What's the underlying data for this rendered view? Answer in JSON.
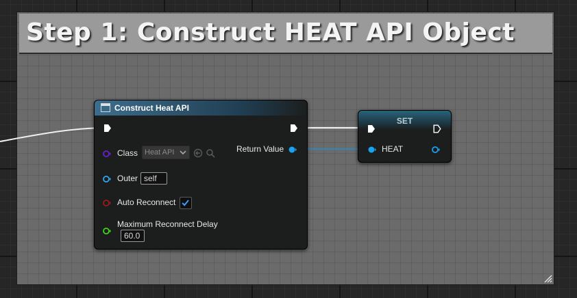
{
  "comment": {
    "title": "Step 1: Construct HEAT API Object"
  },
  "construct_node": {
    "title": "Construct Heat API",
    "icon": "function-icon",
    "header_color": "#3d6d8e",
    "inputs": {
      "class": {
        "label": "Class",
        "value": "Heat API",
        "pin_color": "#6a1fd0"
      },
      "outer": {
        "label": "Outer",
        "value": "self",
        "pin_color": "#2fa7f0"
      },
      "auto_reconnect": {
        "label": "Auto Reconnect",
        "checked": true,
        "pin_color": "#9c1a1a"
      },
      "max_reconnect_delay": {
        "label": "Maximum Reconnect Delay",
        "value": "60.0",
        "pin_color": "#3fd41b"
      }
    },
    "outputs": {
      "return_value": {
        "label": "Return Value",
        "pin_color": "#19a2f0"
      }
    }
  },
  "set_node": {
    "title": "SET",
    "variable": {
      "label": "HEAT",
      "pin_color": "#19a2f0"
    }
  },
  "colors": {
    "exec_wire": "#f0f0f0",
    "object_wire": "#1a8fd6",
    "comment_bg": "#6b6b6b",
    "comment_header": "#9a9a9a"
  }
}
